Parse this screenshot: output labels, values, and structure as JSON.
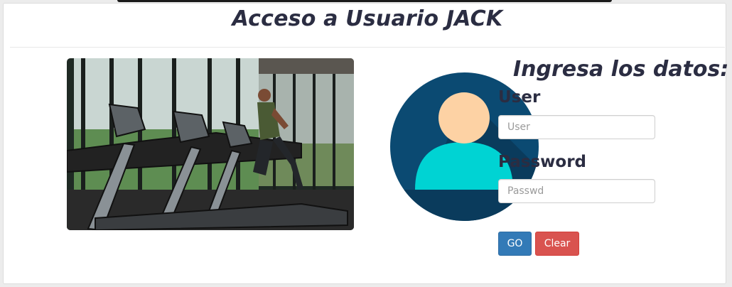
{
  "header": {
    "title": "Acceso a Usuario JACK"
  },
  "form": {
    "heading": "Ingresa los datos:",
    "user_label": "User",
    "user_placeholder": "User",
    "password_label": "Password",
    "password_placeholder": "Passwd",
    "go_label": "GO",
    "clear_label": "Clear"
  },
  "colors": {
    "primary": "#337ab7",
    "danger": "#d9534f",
    "heading": "#2b2d42",
    "avatar_bg": "#0b4a72",
    "avatar_body": "#00d3d3",
    "avatar_skin": "#fdd2a4"
  },
  "images": {
    "gym_photo": "gym-treadmill-photo",
    "avatar": "user-avatar-icon"
  }
}
